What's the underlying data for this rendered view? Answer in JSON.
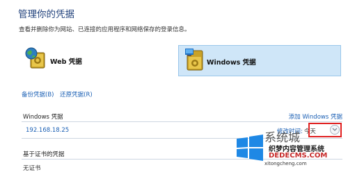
{
  "header": {
    "title": "管理你的凭据",
    "description": "查看并删除你为网站、已连接的应用程序和网络保存的登录信息。"
  },
  "tiles": {
    "web": {
      "label": "Web 凭据",
      "icon": "web-credential-icon"
    },
    "windows": {
      "label": "Windows 凭据",
      "icon": "windows-credential-icon",
      "selected": true
    }
  },
  "actions": {
    "backup": "备份凭据(B)",
    "restore": "还原凭据(R)"
  },
  "windows_credentials": {
    "heading": "Windows 凭据",
    "add_link": "添加 Windows 凭据",
    "entries": [
      {
        "host": "192.168.18.25",
        "modified_label": "修改时间:",
        "modified_value": "今天"
      }
    ]
  },
  "certificate_credentials": {
    "heading": "基于证书的凭据",
    "entry_partial": "无证书"
  },
  "watermark": {
    "big": "系统城",
    "site_name": "织梦内容管理系统",
    "url": "DEDECMS.COM",
    "url2": "xitongcheng.com"
  },
  "colors": {
    "title": "#1e3f7a",
    "link": "#1a5fb4",
    "selected_tile": "#cfe6f8",
    "highlight_box": "#e02020"
  }
}
